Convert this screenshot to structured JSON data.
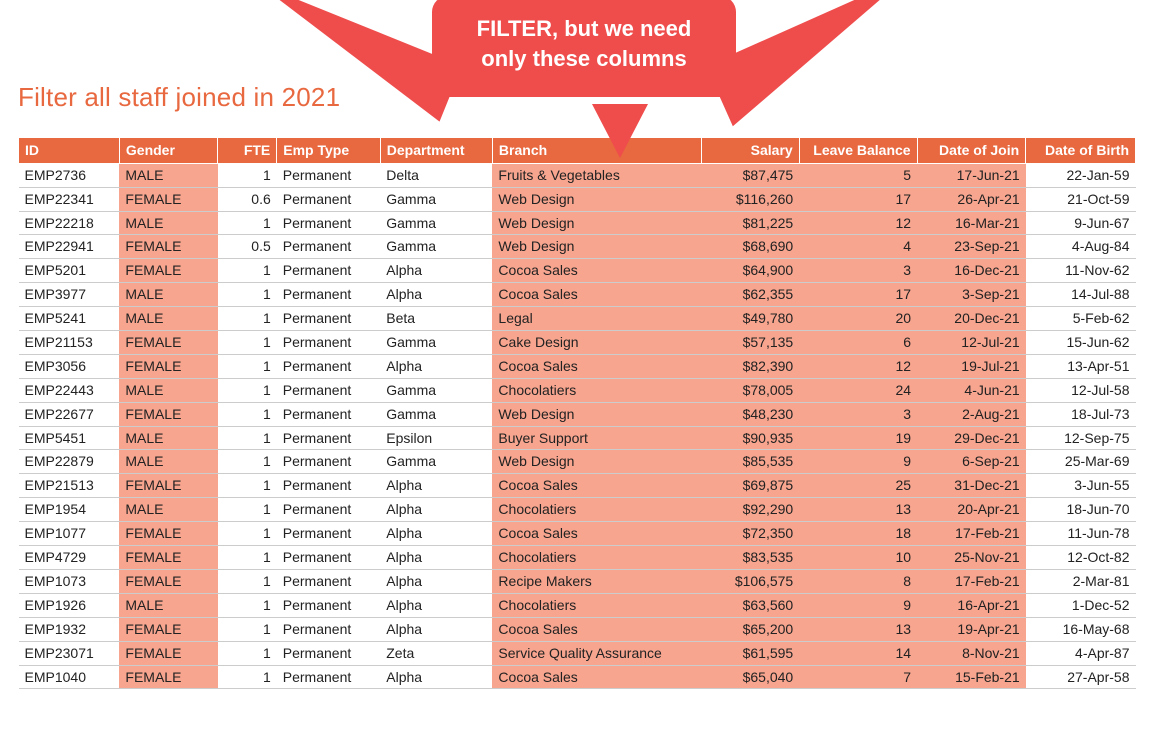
{
  "title": "Filter all staff joined in 2021",
  "callout": "FILTER, but we need only these columns",
  "columns": {
    "id": "ID",
    "gender": "Gender",
    "fte": "FTE",
    "etype": "Emp Type",
    "dept": "Department",
    "branch": "Branch",
    "salary": "Salary",
    "leave": "Leave Balance",
    "doj": "Date of Join",
    "dob": "Date of Birth"
  },
  "highlighted_columns": [
    "gender",
    "branch",
    "salary",
    "leave",
    "doj"
  ],
  "rows": [
    {
      "id": "EMP2736",
      "gender": "MALE",
      "fte": "1",
      "etype": "Permanent",
      "dept": "Delta",
      "branch": "Fruits & Vegetables",
      "salary": "$87,475",
      "leave": "5",
      "doj": "17-Jun-21",
      "dob": "22-Jan-59"
    },
    {
      "id": "EMP22341",
      "gender": "FEMALE",
      "fte": "0.6",
      "etype": "Permanent",
      "dept": "Gamma",
      "branch": "Web Design",
      "salary": "$116,260",
      "leave": "17",
      "doj": "26-Apr-21",
      "dob": "21-Oct-59"
    },
    {
      "id": "EMP22218",
      "gender": "MALE",
      "fte": "1",
      "etype": "Permanent",
      "dept": "Gamma",
      "branch": "Web Design",
      "salary": "$81,225",
      "leave": "12",
      "doj": "16-Mar-21",
      "dob": "9-Jun-67"
    },
    {
      "id": "EMP22941",
      "gender": "FEMALE",
      "fte": "0.5",
      "etype": "Permanent",
      "dept": "Gamma",
      "branch": "Web Design",
      "salary": "$68,690",
      "leave": "4",
      "doj": "23-Sep-21",
      "dob": "4-Aug-84"
    },
    {
      "id": "EMP5201",
      "gender": "FEMALE",
      "fte": "1",
      "etype": "Permanent",
      "dept": "Alpha",
      "branch": "Cocoa Sales",
      "salary": "$64,900",
      "leave": "3",
      "doj": "16-Dec-21",
      "dob": "11-Nov-62"
    },
    {
      "id": "EMP3977",
      "gender": "MALE",
      "fte": "1",
      "etype": "Permanent",
      "dept": "Alpha",
      "branch": "Cocoa Sales",
      "salary": "$62,355",
      "leave": "17",
      "doj": "3-Sep-21",
      "dob": "14-Jul-88"
    },
    {
      "id": "EMP5241",
      "gender": "MALE",
      "fte": "1",
      "etype": "Permanent",
      "dept": "Beta",
      "branch": "Legal",
      "salary": "$49,780",
      "leave": "20",
      "doj": "20-Dec-21",
      "dob": "5-Feb-62"
    },
    {
      "id": "EMP21153",
      "gender": "FEMALE",
      "fte": "1",
      "etype": "Permanent",
      "dept": "Gamma",
      "branch": "Cake Design",
      "salary": "$57,135",
      "leave": "6",
      "doj": "12-Jul-21",
      "dob": "15-Jun-62"
    },
    {
      "id": "EMP3056",
      "gender": "FEMALE",
      "fte": "1",
      "etype": "Permanent",
      "dept": "Alpha",
      "branch": "Cocoa Sales",
      "salary": "$82,390",
      "leave": "12",
      "doj": "19-Jul-21",
      "dob": "13-Apr-51"
    },
    {
      "id": "EMP22443",
      "gender": "MALE",
      "fte": "1",
      "etype": "Permanent",
      "dept": "Gamma",
      "branch": "Chocolatiers",
      "salary": "$78,005",
      "leave": "24",
      "doj": "4-Jun-21",
      "dob": "12-Jul-58"
    },
    {
      "id": "EMP22677",
      "gender": "FEMALE",
      "fte": "1",
      "etype": "Permanent",
      "dept": "Gamma",
      "branch": "Web Design",
      "salary": "$48,230",
      "leave": "3",
      "doj": "2-Aug-21",
      "dob": "18-Jul-73"
    },
    {
      "id": "EMP5451",
      "gender": "MALE",
      "fte": "1",
      "etype": "Permanent",
      "dept": "Epsilon",
      "branch": "Buyer Support",
      "salary": "$90,935",
      "leave": "19",
      "doj": "29-Dec-21",
      "dob": "12-Sep-75"
    },
    {
      "id": "EMP22879",
      "gender": "MALE",
      "fte": "1",
      "etype": "Permanent",
      "dept": "Gamma",
      "branch": "Web Design",
      "salary": "$85,535",
      "leave": "9",
      "doj": "6-Sep-21",
      "dob": "25-Mar-69"
    },
    {
      "id": "EMP21513",
      "gender": "FEMALE",
      "fte": "1",
      "etype": "Permanent",
      "dept": "Alpha",
      "branch": "Cocoa Sales",
      "salary": "$69,875",
      "leave": "25",
      "doj": "31-Dec-21",
      "dob": "3-Jun-55"
    },
    {
      "id": "EMP1954",
      "gender": "MALE",
      "fte": "1",
      "etype": "Permanent",
      "dept": "Alpha",
      "branch": "Chocolatiers",
      "salary": "$92,290",
      "leave": "13",
      "doj": "20-Apr-21",
      "dob": "18-Jun-70"
    },
    {
      "id": "EMP1077",
      "gender": "FEMALE",
      "fte": "1",
      "etype": "Permanent",
      "dept": "Alpha",
      "branch": "Cocoa Sales",
      "salary": "$72,350",
      "leave": "18",
      "doj": "17-Feb-21",
      "dob": "11-Jun-78"
    },
    {
      "id": "EMP4729",
      "gender": "FEMALE",
      "fte": "1",
      "etype": "Permanent",
      "dept": "Alpha",
      "branch": "Chocolatiers",
      "salary": "$83,535",
      "leave": "10",
      "doj": "25-Nov-21",
      "dob": "12-Oct-82"
    },
    {
      "id": "EMP1073",
      "gender": "FEMALE",
      "fte": "1",
      "etype": "Permanent",
      "dept": "Alpha",
      "branch": "Recipe Makers",
      "salary": "$106,575",
      "leave": "8",
      "doj": "17-Feb-21",
      "dob": "2-Mar-81"
    },
    {
      "id": "EMP1926",
      "gender": "MALE",
      "fte": "1",
      "etype": "Permanent",
      "dept": "Alpha",
      "branch": "Chocolatiers",
      "salary": "$63,560",
      "leave": "9",
      "doj": "16-Apr-21",
      "dob": "1-Dec-52"
    },
    {
      "id": "EMP1932",
      "gender": "FEMALE",
      "fte": "1",
      "etype": "Permanent",
      "dept": "Alpha",
      "branch": "Cocoa Sales",
      "salary": "$65,200",
      "leave": "13",
      "doj": "19-Apr-21",
      "dob": "16-May-68"
    },
    {
      "id": "EMP23071",
      "gender": "FEMALE",
      "fte": "1",
      "etype": "Permanent",
      "dept": "Zeta",
      "branch": "Service Quality Assurance",
      "salary": "$61,595",
      "leave": "14",
      "doj": "8-Nov-21",
      "dob": "4-Apr-87"
    },
    {
      "id": "EMP1040",
      "gender": "FEMALE",
      "fte": "1",
      "etype": "Permanent",
      "dept": "Alpha",
      "branch": "Cocoa Sales",
      "salary": "$65,040",
      "leave": "7",
      "doj": "15-Feb-21",
      "dob": "27-Apr-58"
    }
  ]
}
